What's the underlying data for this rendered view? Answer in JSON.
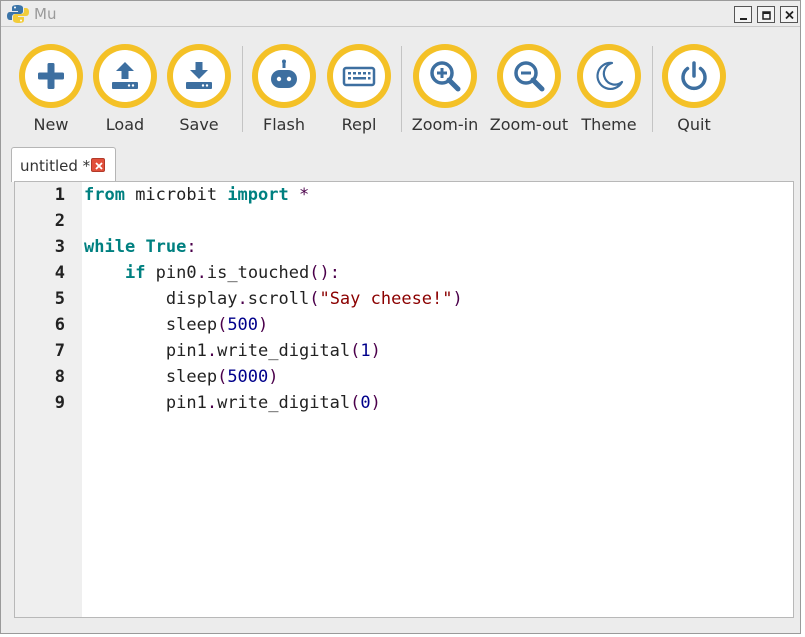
{
  "window": {
    "title": "Mu"
  },
  "toolbar": {
    "buttons": [
      {
        "label": "New",
        "icon": "plus-icon"
      },
      {
        "label": "Load",
        "icon": "upload-icon"
      },
      {
        "label": "Save",
        "icon": "download-icon"
      },
      {
        "label": "Flash",
        "icon": "microbit-icon"
      },
      {
        "label": "Repl",
        "icon": "keyboard-icon"
      },
      {
        "label": "Zoom-in",
        "icon": "zoom-in-icon"
      },
      {
        "label": "Zoom-out",
        "icon": "zoom-out-icon"
      },
      {
        "label": "Theme",
        "icon": "moon-icon"
      },
      {
        "label": "Quit",
        "icon": "power-icon"
      }
    ]
  },
  "tabs": [
    {
      "label": "untitled *",
      "active": true
    }
  ],
  "editor": {
    "line_numbers": [
      "1",
      "2",
      "3",
      "4",
      "5",
      "6",
      "7",
      "8",
      "9"
    ],
    "lines": [
      "from microbit import *",
      "",
      "while True:",
      "    if pin0.is_touched():",
      "        display.scroll(\"Say cheese!\")",
      "        sleep(500)",
      "        pin1.write_digital(1)",
      "        sleep(5000)",
      "        pin1.write_digital(0)"
    ]
  },
  "colors": {
    "accent": "#f4c127",
    "icon": "#3d6fa0",
    "keyword": "#008080",
    "number": "#00008b",
    "string": "#8b0000"
  }
}
